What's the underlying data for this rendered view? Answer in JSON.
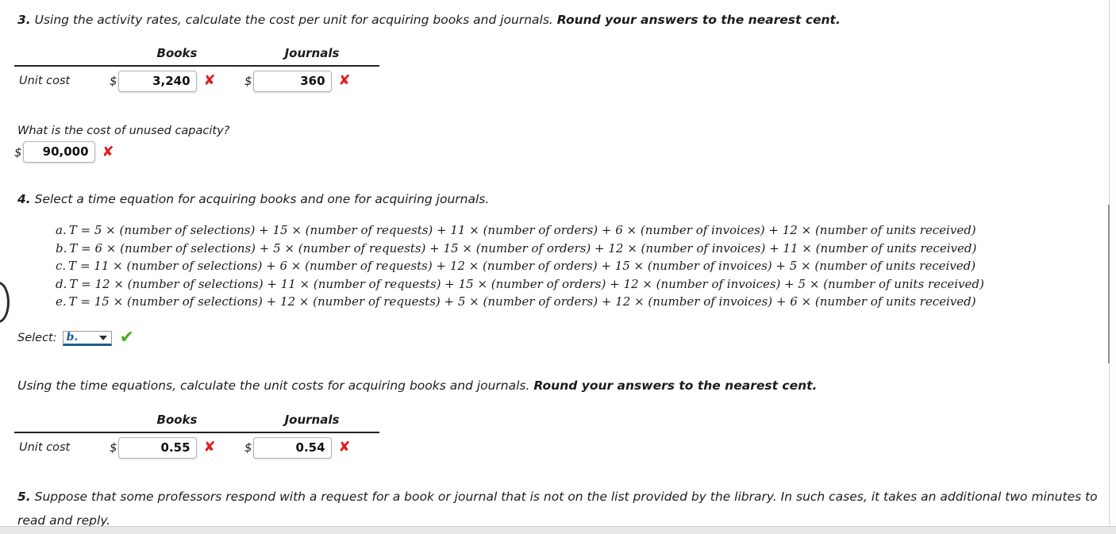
{
  "questions": {
    "q3": {
      "number": "3.",
      "text": " Using the activity rates, calculate the cost per unit for acquiring books and journals. ",
      "emphasis": "Round your answers to the nearest cent."
    },
    "q4": {
      "number": "4.",
      "text": " Select a time equation for acquiring books and one for acquiring journals."
    },
    "q5": {
      "number": "5.",
      "text": " Suppose that some professors respond with a request for a book or journal that is not on the list provided by the library. In such cases, it takes an additional two minutes to read and reply."
    },
    "time_eq_intro": {
      "text": "Using the time equations, calculate the unit costs for acquiring books and journals. ",
      "emphasis": "Round your answers to the nearest cent."
    }
  },
  "table_1": {
    "columns": [
      "Books",
      "Journals"
    ],
    "row_label": "Unit cost",
    "currency": "$",
    "values": [
      "3,240",
      "360"
    ],
    "marks": [
      "✘",
      "✘"
    ]
  },
  "unused_capacity": {
    "label": "What is the cost of unused capacity?",
    "currency": "$",
    "value": "90,000",
    "mark": "✘"
  },
  "table_2": {
    "columns": [
      "Books",
      "Journals"
    ],
    "row_label": "Unit cost",
    "currency": "$",
    "values": [
      "0.55",
      "0.54"
    ],
    "marks": [
      "✘",
      "✘"
    ]
  },
  "choices": [
    {
      "label": "a.",
      "text": "T = 5 × (number of selections) + 15 × (number of requests) + 11 × (number of orders) + 6 × (number of invoices) + 12 × (number of units received)"
    },
    {
      "label": "b.",
      "text": "T = 6 × (number of selections) + 5 × (number of requests) + 15 × (number of orders) + 12 × (number of invoices) + 11 × (number of units received)"
    },
    {
      "label": "c.",
      "text": "T = 11 × (number of selections) + 6 × (number of requests) + 12 × (number of orders) + 15 × (number of invoices) + 5 × (number of units received)"
    },
    {
      "label": "d.",
      "text": "T = 12 × (number of selections) + 11 × (number of requests) + 15 × (number of orders) + 12 × (number of invoices) + 5 × (number of units received)"
    },
    {
      "label": "e.",
      "text": "T = 15 × (number of selections) + 12 × (number of requests) + 5 × (number of orders) + 12 × (number of invoices) + 6 × (number of units received)"
    }
  ],
  "select": {
    "label": "Select:",
    "value": "b.",
    "options": [
      "a.",
      "b.",
      "c.",
      "d.",
      "e."
    ],
    "mark": "✔"
  },
  "colors": {
    "wrong": "#e01b1b",
    "correct": "#4caf1e",
    "select_accent": "#1b5e8f"
  }
}
